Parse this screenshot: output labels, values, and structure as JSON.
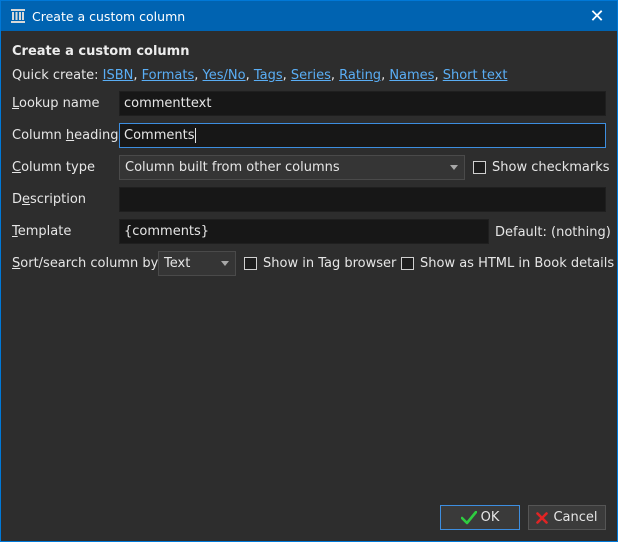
{
  "window": {
    "title": "Create a custom column",
    "close_glyph": "✕"
  },
  "form": {
    "heading": "Create a custom column",
    "quick_create": {
      "label": "Quick create: ",
      "links": [
        "ISBN",
        "Formats",
        "Yes/No",
        "Tags",
        "Series",
        "Rating",
        "Names",
        "Short text"
      ]
    },
    "lookup_name": {
      "label": "Lookup name",
      "value": "commenttext"
    },
    "column_heading": {
      "label_pre": "Column ",
      "label_ul": "h",
      "label_post": "eading",
      "value": "Comments"
    },
    "column_type": {
      "label": "Column type",
      "value": "Column built from other columns"
    },
    "show_checkmarks": {
      "label": "Show checkmarks",
      "checked": false
    },
    "description": {
      "label_pre": "D",
      "label_ul": "e",
      "label_post": "scription",
      "value": ""
    },
    "template": {
      "label": "Template",
      "value": "{comments}"
    },
    "default_label": "Default: (nothing)",
    "sort_search": {
      "label": "Sort/search column by",
      "value": "Text"
    },
    "show_in_tag_browser": {
      "label": "Show in Tag browser",
      "checked": false
    },
    "show_as_html": {
      "label": "Show as HTML in Book details",
      "checked": false
    }
  },
  "buttons": {
    "ok": "OK",
    "cancel": "Cancel"
  },
  "colors": {
    "accent": "#3d8ee0",
    "link": "#5aaef5",
    "titlebar": "#0063b1",
    "ok_icon": "#2ecc40",
    "cancel_icon": "#e02424"
  },
  "icons": {
    "app": "calibre-library-icon",
    "ok": "checkmark-icon",
    "cancel": "x-icon"
  }
}
